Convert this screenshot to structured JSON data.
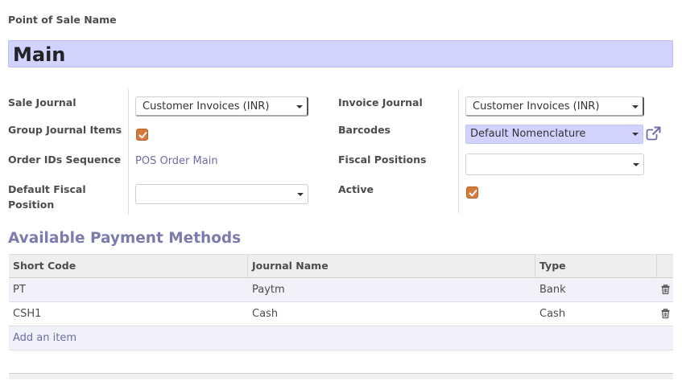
{
  "form": {
    "pos_name_label": "Point of Sale Name",
    "pos_name_value": "Main"
  },
  "left_fields": {
    "sale_journal_label": "Sale Journal",
    "sale_journal_value": "Customer Invoices (INR)",
    "group_journal_label": "Group Journal Items",
    "group_journal_checked": true,
    "order_seq_label": "Order IDs Sequence",
    "order_seq_value": "POS Order Main",
    "fiscal_position_label_1": "Default Fiscal",
    "fiscal_position_label_2": "Position",
    "fiscal_position_value": ""
  },
  "right_fields": {
    "invoice_journal_label": "Invoice Journal",
    "invoice_journal_value": "Customer Invoices (INR)",
    "barcodes_label": "Barcodes",
    "barcodes_value": "Default Nomenclature",
    "fiscal_positions_label": "Fiscal Positions",
    "fiscal_positions_value": "",
    "active_label": "Active",
    "active_checked": true
  },
  "payment_methods": {
    "title": "Available Payment Methods",
    "headers": [
      "Short Code",
      "Journal Name",
      "Type"
    ],
    "rows": [
      {
        "code": "PT",
        "journal": "Paytm",
        "type": "Bank"
      },
      {
        "code": "CSH1",
        "journal": "Cash",
        "type": "Cash"
      }
    ],
    "add_item_label": "Add an item"
  },
  "colors": {
    "accent": "#7c7bad",
    "highlight": "#d2d2ff",
    "checkbox": "#d67a3c"
  },
  "icons": {
    "checkbox": "check-icon",
    "external": "external-link-icon",
    "delete": "trash-icon",
    "dropdown": "caret-down-icon"
  }
}
